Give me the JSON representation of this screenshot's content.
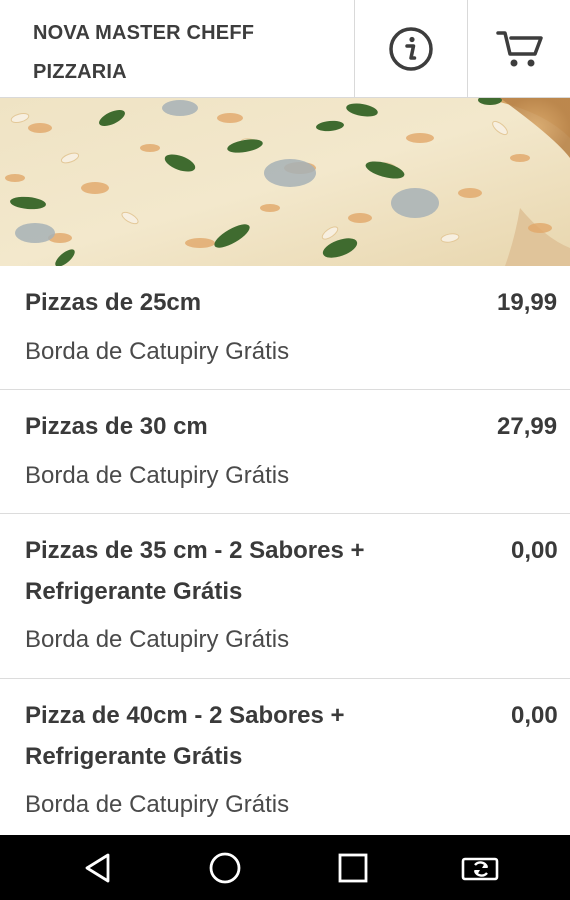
{
  "header": {
    "title_line1": "NOVA MASTER CHEFF",
    "title_line2": "PIZZARIA",
    "info_icon": "info-circle-icon",
    "cart_icon": "shopping-cart-icon"
  },
  "menu": {
    "items": [
      {
        "title": "Pizzas de 25cm",
        "price": "19,99",
        "description": "Borda de Catupiry Grátis"
      },
      {
        "title": "Pizzas de 30 cm",
        "price": "27,99",
        "description": "Borda de Catupiry Grátis"
      },
      {
        "title_line1": "Pizzas de 35 cm - 2 Sabores +",
        "title_line2": "Refrigerante Grátis",
        "price": "0,00",
        "description": "Borda de Catupiry Grátis"
      },
      {
        "title_line1": "Pizza de 40cm - 2 Sabores +",
        "title_line2": "Refrigerante Grátis",
        "price": "0,00",
        "description": "Borda de Catupiry Grátis"
      }
    ]
  },
  "navbar": {
    "back_icon": "back-triangle-icon",
    "home_icon": "home-circle-icon",
    "recents_icon": "recents-square-icon",
    "rotate_icon": "screen-rotate-icon"
  },
  "colors": {
    "header_bg": "#ffffff",
    "text": "#3a3a3a",
    "divider": "#dcdcdc",
    "navbar_bg": "#000000"
  }
}
